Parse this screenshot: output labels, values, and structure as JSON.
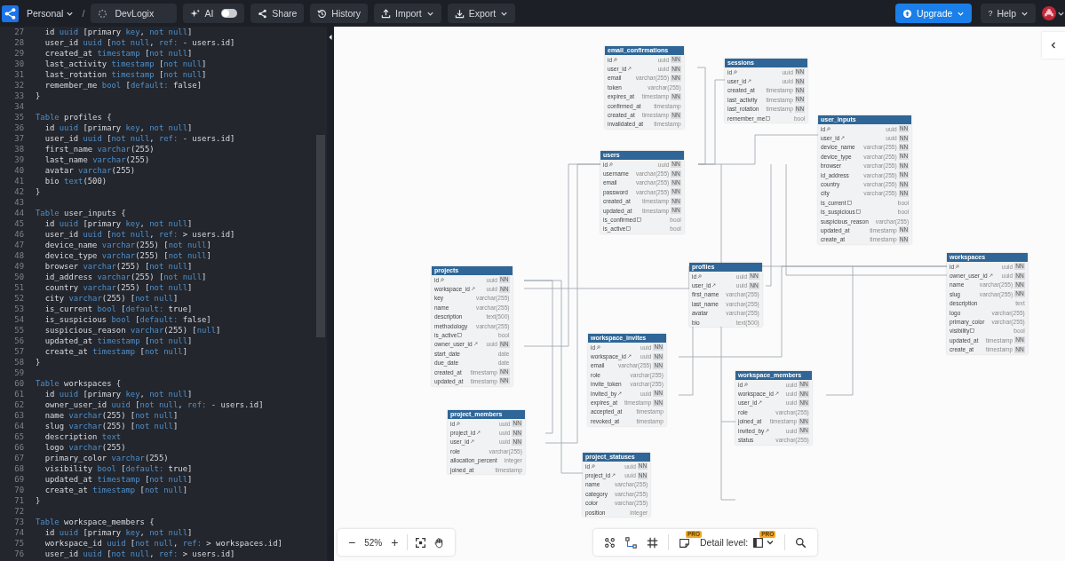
{
  "topbar": {
    "workspace": "Personal",
    "separator": "/",
    "project_name": "DevLogix",
    "ai": {
      "label": "AI",
      "on": false
    },
    "buttons": [
      {
        "label": "Share",
        "kind": "share",
        "menu": false
      },
      {
        "label": "History",
        "kind": "history",
        "menu": false
      },
      {
        "label": "Import",
        "kind": "import",
        "menu": true
      },
      {
        "label": "Export",
        "kind": "export",
        "menu": true
      }
    ],
    "upgrade": "Upgrade",
    "help": {
      "icon": "?",
      "label": "Help"
    }
  },
  "editor": {
    "lines": [
      {
        "n": "27",
        "tokens": [
          {
            "text": "  id ",
            "kind": "plain"
          },
          {
            "text": "uuid",
            "kind": "keyword"
          },
          {
            "text": " [primary ",
            "kind": "plain"
          },
          {
            "text": "key",
            "kind": "keyword"
          },
          {
            "text": ", ",
            "kind": "plain"
          },
          {
            "text": "not null",
            "kind": "keyword"
          },
          {
            "text": "]",
            "kind": "plain"
          }
        ]
      },
      {
        "n": "28",
        "tokens": [
          {
            "text": "  user_id ",
            "kind": "plain"
          },
          {
            "text": "uuid",
            "kind": "keyword"
          },
          {
            "text": " [",
            "kind": "plain"
          },
          {
            "text": "not null",
            "kind": "keyword"
          },
          {
            "text": ", ",
            "kind": "plain"
          },
          {
            "text": "ref:",
            "kind": "keyword"
          },
          {
            "text": " - users.id]",
            "kind": "plain"
          }
        ]
      },
      {
        "n": "29",
        "tokens": [
          {
            "text": "  created_at ",
            "kind": "plain"
          },
          {
            "text": "timestamp",
            "kind": "keyword"
          },
          {
            "text": " [",
            "kind": "plain"
          },
          {
            "text": "not null",
            "kind": "keyword"
          },
          {
            "text": "]",
            "kind": "plain"
          }
        ]
      },
      {
        "n": "30",
        "tokens": [
          {
            "text": "  last_activity ",
            "kind": "plain"
          },
          {
            "text": "timestamp",
            "kind": "keyword"
          },
          {
            "text": " [",
            "kind": "plain"
          },
          {
            "text": "not null",
            "kind": "keyword"
          },
          {
            "text": "]",
            "kind": "plain"
          }
        ]
      },
      {
        "n": "31",
        "tokens": [
          {
            "text": "  last_rotation ",
            "kind": "plain"
          },
          {
            "text": "timestamp",
            "kind": "keyword"
          },
          {
            "text": " [",
            "kind": "plain"
          },
          {
            "text": "not null",
            "kind": "keyword"
          },
          {
            "text": "]",
            "kind": "plain"
          }
        ]
      },
      {
        "n": "32",
        "tokens": [
          {
            "text": "  remember_me ",
            "kind": "plain"
          },
          {
            "text": "bool",
            "kind": "keyword"
          },
          {
            "text": " [",
            "kind": "plain"
          },
          {
            "text": "default:",
            "kind": "keyword"
          },
          {
            "text": " false]",
            "kind": "plain"
          }
        ]
      },
      {
        "n": "33",
        "tokens": [
          {
            "text": "}",
            "kind": "plain"
          }
        ]
      },
      {
        "n": "34"
      },
      {
        "n": "35",
        "tokens": [
          {
            "text": "Table",
            "kind": "keyword"
          },
          {
            "text": " profiles {",
            "kind": "plain"
          }
        ]
      },
      {
        "n": "36",
        "tokens": [
          {
            "text": "  id ",
            "kind": "plain"
          },
          {
            "text": "uuid",
            "kind": "keyword"
          },
          {
            "text": " [primary ",
            "kind": "plain"
          },
          {
            "text": "key",
            "kind": "keyword"
          },
          {
            "text": ", ",
            "kind": "plain"
          },
          {
            "text": "not null",
            "kind": "keyword"
          },
          {
            "text": "]",
            "kind": "plain"
          }
        ]
      },
      {
        "n": "37",
        "tokens": [
          {
            "text": "  user_id ",
            "kind": "plain"
          },
          {
            "text": "uuid",
            "kind": "keyword"
          },
          {
            "text": " [",
            "kind": "plain"
          },
          {
            "text": "not null",
            "kind": "keyword"
          },
          {
            "text": ", ",
            "kind": "plain"
          },
          {
            "text": "ref:",
            "kind": "keyword"
          },
          {
            "text": " - users.id]",
            "kind": "plain"
          }
        ]
      },
      {
        "n": "38",
        "tokens": [
          {
            "text": "  first_name ",
            "kind": "plain"
          },
          {
            "text": "varchar",
            "kind": "keyword"
          },
          {
            "text": "(255)",
            "kind": "plain"
          }
        ]
      },
      {
        "n": "39",
        "tokens": [
          {
            "text": "  last_name ",
            "kind": "plain"
          },
          {
            "text": "varchar",
            "kind": "keyword"
          },
          {
            "text": "(255)",
            "kind": "plain"
          }
        ]
      },
      {
        "n": "40",
        "tokens": [
          {
            "text": "  avatar ",
            "kind": "plain"
          },
          {
            "text": "varchar",
            "kind": "keyword"
          },
          {
            "text": "(255)",
            "kind": "plain"
          }
        ]
      },
      {
        "n": "41",
        "tokens": [
          {
            "text": "  bio ",
            "kind": "plain"
          },
          {
            "text": "text",
            "kind": "keyword"
          },
          {
            "text": "(500)",
            "kind": "plain"
          }
        ]
      },
      {
        "n": "42",
        "tokens": [
          {
            "text": "}",
            "kind": "plain"
          }
        ]
      },
      {
        "n": "43"
      },
      {
        "n": "44",
        "tokens": [
          {
            "text": "Table",
            "kind": "keyword"
          },
          {
            "text": " user_inputs {",
            "kind": "plain"
          }
        ]
      },
      {
        "n": "45",
        "tokens": [
          {
            "text": "  id ",
            "kind": "plain"
          },
          {
            "text": "uuid",
            "kind": "keyword"
          },
          {
            "text": " [primary ",
            "kind": "plain"
          },
          {
            "text": "key",
            "kind": "keyword"
          },
          {
            "text": ", ",
            "kind": "plain"
          },
          {
            "text": "not null",
            "kind": "keyword"
          },
          {
            "text": "]",
            "kind": "plain"
          }
        ]
      },
      {
        "n": "46",
        "tokens": [
          {
            "text": "  user_id ",
            "kind": "plain"
          },
          {
            "text": "uuid",
            "kind": "keyword"
          },
          {
            "text": " [",
            "kind": "plain"
          },
          {
            "text": "not null",
            "kind": "keyword"
          },
          {
            "text": ", ",
            "kind": "plain"
          },
          {
            "text": "ref:",
            "kind": "keyword"
          },
          {
            "text": " > users.id]",
            "kind": "plain"
          }
        ]
      },
      {
        "n": "47",
        "tokens": [
          {
            "text": "  device_name ",
            "kind": "plain"
          },
          {
            "text": "varchar",
            "kind": "keyword"
          },
          {
            "text": "(255) [",
            "kind": "plain"
          },
          {
            "text": "not null",
            "kind": "keyword"
          },
          {
            "text": "]",
            "kind": "plain"
          }
        ]
      },
      {
        "n": "48",
        "tokens": [
          {
            "text": "  device_type ",
            "kind": "plain"
          },
          {
            "text": "varchar",
            "kind": "keyword"
          },
          {
            "text": "(255) [",
            "kind": "plain"
          },
          {
            "text": "not null",
            "kind": "keyword"
          },
          {
            "text": "]",
            "kind": "plain"
          }
        ]
      },
      {
        "n": "49",
        "tokens": [
          {
            "text": "  browser ",
            "kind": "plain"
          },
          {
            "text": "varchar",
            "kind": "keyword"
          },
          {
            "text": "(255) [",
            "kind": "plain"
          },
          {
            "text": "not null",
            "kind": "keyword"
          },
          {
            "text": "]",
            "kind": "plain"
          }
        ]
      },
      {
        "n": "50",
        "tokens": [
          {
            "text": "  id_address ",
            "kind": "plain"
          },
          {
            "text": "varchar",
            "kind": "keyword"
          },
          {
            "text": "(255) [",
            "kind": "plain"
          },
          {
            "text": "not null",
            "kind": "keyword"
          },
          {
            "text": "]",
            "kind": "plain"
          }
        ]
      },
      {
        "n": "51",
        "tokens": [
          {
            "text": "  country ",
            "kind": "plain"
          },
          {
            "text": "varchar",
            "kind": "keyword"
          },
          {
            "text": "(255) [",
            "kind": "plain"
          },
          {
            "text": "not null",
            "kind": "keyword"
          },
          {
            "text": "]",
            "kind": "plain"
          }
        ]
      },
      {
        "n": "52",
        "tokens": [
          {
            "text": "  city ",
            "kind": "plain"
          },
          {
            "text": "varchar",
            "kind": "keyword"
          },
          {
            "text": "(255) [",
            "kind": "plain"
          },
          {
            "text": "not null",
            "kind": "keyword"
          },
          {
            "text": "]",
            "kind": "plain"
          }
        ]
      },
      {
        "n": "53",
        "tokens": [
          {
            "text": "  is_current ",
            "kind": "plain"
          },
          {
            "text": "bool",
            "kind": "keyword"
          },
          {
            "text": " [",
            "kind": "plain"
          },
          {
            "text": "default:",
            "kind": "keyword"
          },
          {
            "text": " true]",
            "kind": "plain"
          }
        ]
      },
      {
        "n": "54",
        "tokens": [
          {
            "text": "  is_suspicious ",
            "kind": "plain"
          },
          {
            "text": "bool",
            "kind": "keyword"
          },
          {
            "text": " [",
            "kind": "plain"
          },
          {
            "text": "default:",
            "kind": "keyword"
          },
          {
            "text": " false]",
            "kind": "plain"
          }
        ]
      },
      {
        "n": "55",
        "tokens": [
          {
            "text": "  suspicious_reason ",
            "kind": "plain"
          },
          {
            "text": "varchar",
            "kind": "keyword"
          },
          {
            "text": "(255) [",
            "kind": "plain"
          },
          {
            "text": "null",
            "kind": "keyword"
          },
          {
            "text": "]",
            "kind": "plain"
          }
        ]
      },
      {
        "n": "56",
        "tokens": [
          {
            "text": "  updated_at ",
            "kind": "plain"
          },
          {
            "text": "timestamp",
            "kind": "keyword"
          },
          {
            "text": " [",
            "kind": "plain"
          },
          {
            "text": "not null",
            "kind": "keyword"
          },
          {
            "text": "]",
            "kind": "plain"
          }
        ]
      },
      {
        "n": "57",
        "tokens": [
          {
            "text": "  create_at ",
            "kind": "plain"
          },
          {
            "text": "timestamp",
            "kind": "keyword"
          },
          {
            "text": " [",
            "kind": "plain"
          },
          {
            "text": "not null",
            "kind": "keyword"
          },
          {
            "text": "]",
            "kind": "plain"
          }
        ]
      },
      {
        "n": "58",
        "tokens": [
          {
            "text": "}",
            "kind": "plain"
          }
        ]
      },
      {
        "n": "59"
      },
      {
        "n": "60",
        "tokens": [
          {
            "text": "Table",
            "kind": "keyword"
          },
          {
            "text": " workspaces {",
            "kind": "plain"
          }
        ]
      },
      {
        "n": "61",
        "tokens": [
          {
            "text": "  id ",
            "kind": "plain"
          },
          {
            "text": "uuid",
            "kind": "keyword"
          },
          {
            "text": " [primary ",
            "kind": "plain"
          },
          {
            "text": "key",
            "kind": "keyword"
          },
          {
            "text": ", ",
            "kind": "plain"
          },
          {
            "text": "not null",
            "kind": "keyword"
          },
          {
            "text": "]",
            "kind": "plain"
          }
        ]
      },
      {
        "n": "62",
        "tokens": [
          {
            "text": "  owner_user_id ",
            "kind": "plain"
          },
          {
            "text": "uuid",
            "kind": "keyword"
          },
          {
            "text": " [",
            "kind": "plain"
          },
          {
            "text": "not null",
            "kind": "keyword"
          },
          {
            "text": ", ",
            "kind": "plain"
          },
          {
            "text": "ref:",
            "kind": "keyword"
          },
          {
            "text": " - users.id]",
            "kind": "plain"
          }
        ]
      },
      {
        "n": "63",
        "tokens": [
          {
            "text": "  name ",
            "kind": "plain"
          },
          {
            "text": "varchar",
            "kind": "keyword"
          },
          {
            "text": "(255) [",
            "kind": "plain"
          },
          {
            "text": "not null",
            "kind": "keyword"
          },
          {
            "text": "]",
            "kind": "plain"
          }
        ]
      },
      {
        "n": "64",
        "tokens": [
          {
            "text": "  slug ",
            "kind": "plain"
          },
          {
            "text": "varchar",
            "kind": "keyword"
          },
          {
            "text": "(255) [",
            "kind": "plain"
          },
          {
            "text": "not null",
            "kind": "keyword"
          },
          {
            "text": "]",
            "kind": "plain"
          }
        ]
      },
      {
        "n": "65",
        "tokens": [
          {
            "text": "  description ",
            "kind": "plain"
          },
          {
            "text": "text",
            "kind": "keyword"
          }
        ]
      },
      {
        "n": "66",
        "tokens": [
          {
            "text": "  logo ",
            "kind": "plain"
          },
          {
            "text": "varchar",
            "kind": "keyword"
          },
          {
            "text": "(255)",
            "kind": "plain"
          }
        ]
      },
      {
        "n": "67",
        "tokens": [
          {
            "text": "  primary_color ",
            "kind": "plain"
          },
          {
            "text": "varchar",
            "kind": "keyword"
          },
          {
            "text": "(255)",
            "kind": "plain"
          }
        ]
      },
      {
        "n": "68",
        "tokens": [
          {
            "text": "  visibility ",
            "kind": "plain"
          },
          {
            "text": "bool",
            "kind": "keyword"
          },
          {
            "text": " [",
            "kind": "plain"
          },
          {
            "text": "default:",
            "kind": "keyword"
          },
          {
            "text": " true]",
            "kind": "plain"
          }
        ]
      },
      {
        "n": "69",
        "tokens": [
          {
            "text": "  updated_at ",
            "kind": "plain"
          },
          {
            "text": "timestamp",
            "kind": "keyword"
          },
          {
            "text": " [",
            "kind": "plain"
          },
          {
            "text": "not null",
            "kind": "keyword"
          },
          {
            "text": "]",
            "kind": "plain"
          }
        ]
      },
      {
        "n": "70",
        "tokens": [
          {
            "text": "  create_at ",
            "kind": "plain"
          },
          {
            "text": "timestamp",
            "kind": "keyword"
          },
          {
            "text": " [",
            "kind": "plain"
          },
          {
            "text": "not null",
            "kind": "keyword"
          },
          {
            "text": "]",
            "kind": "plain"
          }
        ]
      },
      {
        "n": "71",
        "tokens": [
          {
            "text": "}",
            "kind": "plain"
          }
        ]
      },
      {
        "n": "72"
      },
      {
        "n": "73",
        "tokens": [
          {
            "text": "Table",
            "kind": "keyword"
          },
          {
            "text": " workspace_members {",
            "kind": "plain"
          }
        ]
      },
      {
        "n": "74",
        "tokens": [
          {
            "text": "  id ",
            "kind": "plain"
          },
          {
            "text": "uuid",
            "kind": "keyword"
          },
          {
            "text": " [primary ",
            "kind": "plain"
          },
          {
            "text": "key",
            "kind": "keyword"
          },
          {
            "text": ", ",
            "kind": "plain"
          },
          {
            "text": "not null",
            "kind": "keyword"
          },
          {
            "text": "]",
            "kind": "plain"
          }
        ]
      },
      {
        "n": "75",
        "tokens": [
          {
            "text": "  workspace_id ",
            "kind": "plain"
          },
          {
            "text": "uuid",
            "kind": "keyword"
          },
          {
            "text": " [",
            "kind": "plain"
          },
          {
            "text": "not null",
            "kind": "keyword"
          },
          {
            "text": ", ",
            "kind": "plain"
          },
          {
            "text": "ref:",
            "kind": "keyword"
          },
          {
            "text": " > workspaces.id]",
            "kind": "plain"
          }
        ]
      },
      {
        "n": "76",
        "tokens": [
          {
            "text": "  user_id ",
            "kind": "plain"
          },
          {
            "text": "uuid",
            "kind": "keyword"
          },
          {
            "text": " [",
            "kind": "plain"
          },
          {
            "text": "not null",
            "kind": "keyword"
          },
          {
            "text": ", ",
            "kind": "plain"
          },
          {
            "text": "ref:",
            "kind": "keyword"
          },
          {
            "text": " > users.id]",
            "kind": "plain"
          }
        ]
      }
    ]
  },
  "diagram": {
    "tables": [
      {
        "name": "email_confirmations",
        "fields": [
          {
            "name": "id",
            "kind": "pk",
            "type": "uuid",
            "badge": "NN"
          },
          {
            "name": "user_id",
            "kind": "fk",
            "type": "uuid",
            "badge": "NN"
          },
          {
            "name": "email",
            "type": "varchar(255)",
            "badge": "NN"
          },
          {
            "name": "token",
            "type": "varchar(255)"
          },
          {
            "name": "expires_at",
            "type": "timestamp",
            "badge": "NN"
          },
          {
            "name": "confirmed_at",
            "type": "timestamp"
          },
          {
            "name": "created_at",
            "type": "timestamp",
            "badge": "NN"
          },
          {
            "name": "invalidated_at",
            "type": "timestamp"
          }
        ]
      },
      {
        "name": "sessions",
        "fields": [
          {
            "name": "id",
            "kind": "pk",
            "type": "uuid",
            "badge": "NN"
          },
          {
            "name": "user_id",
            "kind": "fk",
            "type": "uuid",
            "badge": "NN"
          },
          {
            "name": "created_at",
            "type": "timestamp",
            "badge": "NN"
          },
          {
            "name": "last_activity",
            "type": "timestamp",
            "badge": "NN"
          },
          {
            "name": "last_rotation",
            "type": "timestamp",
            "badge": "NN"
          },
          {
            "name": "remember_me",
            "kind": "note",
            "type": "bool"
          }
        ]
      },
      {
        "name": "user_inputs",
        "fields": [
          {
            "name": "id",
            "kind": "pk",
            "type": "uuid",
            "badge": "NN"
          },
          {
            "name": "user_id",
            "kind": "fk",
            "type": "uuid",
            "badge": "NN"
          },
          {
            "name": "device_name",
            "type": "varchar(255)",
            "badge": "NN"
          },
          {
            "name": "device_type",
            "type": "varchar(255)",
            "badge": "NN"
          },
          {
            "name": "browser",
            "type": "varchar(255)",
            "badge": "NN"
          },
          {
            "name": "id_address",
            "type": "varchar(255)",
            "badge": "NN"
          },
          {
            "name": "country",
            "type": "varchar(255)",
            "badge": "NN"
          },
          {
            "name": "city",
            "type": "varchar(255)",
            "badge": "NN"
          },
          {
            "name": "is_current",
            "kind": "note",
            "type": "bool"
          },
          {
            "name": "is_suspicious",
            "kind": "note",
            "type": "bool"
          },
          {
            "name": "suspicious_reason",
            "type": "varchar(255)"
          },
          {
            "name": "updated_at",
            "type": "timestamp",
            "badge": "NN"
          },
          {
            "name": "create_at",
            "type": "timestamp",
            "badge": "NN"
          }
        ]
      },
      {
        "name": "users",
        "fields": [
          {
            "name": "id",
            "kind": "pk",
            "type": "uuid",
            "badge": "NN"
          },
          {
            "name": "username",
            "type": "varchar(255)",
            "badge": "NN"
          },
          {
            "name": "email",
            "type": "varchar(255)",
            "badge": "NN"
          },
          {
            "name": "password",
            "type": "varchar(255)",
            "badge": "NN"
          },
          {
            "name": "created_at",
            "type": "timestamp",
            "badge": "NN"
          },
          {
            "name": "updated_at",
            "type": "timestamp",
            "badge": "NN"
          },
          {
            "name": "is_confirmed",
            "kind": "note",
            "type": "bool"
          },
          {
            "name": "is_active",
            "kind": "note",
            "type": "bool"
          }
        ]
      },
      {
        "name": "workspaces",
        "fields": [
          {
            "name": "id",
            "kind": "pk",
            "type": "uuid",
            "badge": "NN"
          },
          {
            "name": "owner_user_id",
            "kind": "fk",
            "type": "uuid",
            "badge": "NN"
          },
          {
            "name": "name",
            "type": "varchar(255)",
            "badge": "NN"
          },
          {
            "name": "slug",
            "type": "varchar(255)",
            "badge": "NN"
          },
          {
            "name": "description",
            "type": "text"
          },
          {
            "name": "logo",
            "type": "varchar(255)"
          },
          {
            "name": "primary_color",
            "type": "varchar(255)"
          },
          {
            "name": "visibility",
            "kind": "note",
            "type": "bool"
          },
          {
            "name": "updated_at",
            "type": "timestamp",
            "badge": "NN"
          },
          {
            "name": "create_at",
            "type": "timestamp",
            "badge": "NN"
          }
        ]
      },
      {
        "name": "profiles",
        "fields": [
          {
            "name": "id",
            "kind": "pk",
            "type": "uuid",
            "badge": "NN"
          },
          {
            "name": "user_id",
            "kind": "fk",
            "type": "uuid",
            "badge": "NN"
          },
          {
            "name": "first_name",
            "type": "varchar(255)"
          },
          {
            "name": "last_name",
            "type": "varchar(255)"
          },
          {
            "name": "avatar",
            "type": "varchar(255)"
          },
          {
            "name": "bio",
            "type": "text(500)"
          }
        ]
      },
      {
        "name": "projects",
        "fields": [
          {
            "name": "id",
            "kind": "pk",
            "type": "uuid",
            "badge": "NN"
          },
          {
            "name": "workspace_id",
            "kind": "fk",
            "type": "uuid",
            "badge": "NN"
          },
          {
            "name": "key",
            "type": "varchar(255)"
          },
          {
            "name": "name",
            "type": "varchar(255)"
          },
          {
            "name": "description",
            "type": "text(500)"
          },
          {
            "name": "methodology",
            "type": "varchar(255)"
          },
          {
            "name": "is_active",
            "kind": "note",
            "type": "bool"
          },
          {
            "name": "owner_user_id",
            "kind": "fk",
            "type": "uuid",
            "badge": "NN"
          },
          {
            "name": "start_date",
            "type": "date"
          },
          {
            "name": "due_date",
            "type": "date"
          },
          {
            "name": "created_at",
            "type": "timestamp",
            "badge": "NN"
          },
          {
            "name": "updated_at",
            "type": "timestamp",
            "badge": "NN"
          }
        ]
      },
      {
        "name": "workspace_invites",
        "fields": [
          {
            "name": "id",
            "kind": "pk",
            "type": "uuid",
            "badge": "NN"
          },
          {
            "name": "workspace_id",
            "kind": "fk",
            "type": "uuid",
            "badge": "NN"
          },
          {
            "name": "email",
            "type": "varchar(255)",
            "badge": "NN"
          },
          {
            "name": "role",
            "type": "varchar(255)"
          },
          {
            "name": "invite_token",
            "type": "varchar(255)"
          },
          {
            "name": "invited_by",
            "kind": "fk",
            "type": "uuid",
            "badge": "NN"
          },
          {
            "name": "expires_at",
            "type": "timestamp",
            "badge": "NN"
          },
          {
            "name": "accepted_at",
            "type": "timestamp"
          },
          {
            "name": "revoked_at",
            "type": "timestamp"
          }
        ]
      },
      {
        "name": "workspace_members",
        "fields": [
          {
            "name": "id",
            "kind": "pk",
            "type": "uuid",
            "badge": "NN"
          },
          {
            "name": "workspace_id",
            "kind": "fk",
            "type": "uuid",
            "badge": "NN"
          },
          {
            "name": "user_id",
            "kind": "fk",
            "type": "uuid",
            "badge": "NN"
          },
          {
            "name": "role",
            "type": "varchar(255)"
          },
          {
            "name": "joined_at",
            "type": "timestamp",
            "badge": "NN"
          },
          {
            "name": "invited_by",
            "kind": "fk",
            "type": "uuid",
            "badge": "NN"
          },
          {
            "name": "status",
            "type": "varchar(255)"
          }
        ]
      },
      {
        "name": "project_members",
        "fields": [
          {
            "name": "id",
            "kind": "pk",
            "type": "uuid",
            "badge": "NN"
          },
          {
            "name": "project_id",
            "kind": "fk",
            "type": "uuid",
            "badge": "NN"
          },
          {
            "name": "user_id",
            "kind": "fk",
            "type": "uuid",
            "badge": "NN"
          },
          {
            "name": "role",
            "type": "varchar(255)"
          },
          {
            "name": "allocation_percent",
            "type": "integer"
          },
          {
            "name": "joined_at",
            "type": "timestamp"
          }
        ]
      },
      {
        "name": "project_statuses",
        "fields": [
          {
            "name": "id",
            "kind": "pk",
            "type": "uuid",
            "badge": "NN"
          },
          {
            "name": "project_id",
            "kind": "fk",
            "type": "uuid",
            "badge": "NN"
          },
          {
            "name": "name",
            "type": "varchar(255)"
          },
          {
            "name": "category",
            "type": "varchar(255)"
          },
          {
            "name": "color",
            "type": "varchar(255)"
          },
          {
            "name": "position",
            "type": "integer"
          }
        ]
      }
    ]
  },
  "zoom": {
    "minus": "−",
    "level_text": "52%",
    "plus": "+"
  },
  "toolbar": {
    "note_badge": "PRO",
    "detail_label": "Detail level:",
    "detail_badge": "PRO"
  }
}
